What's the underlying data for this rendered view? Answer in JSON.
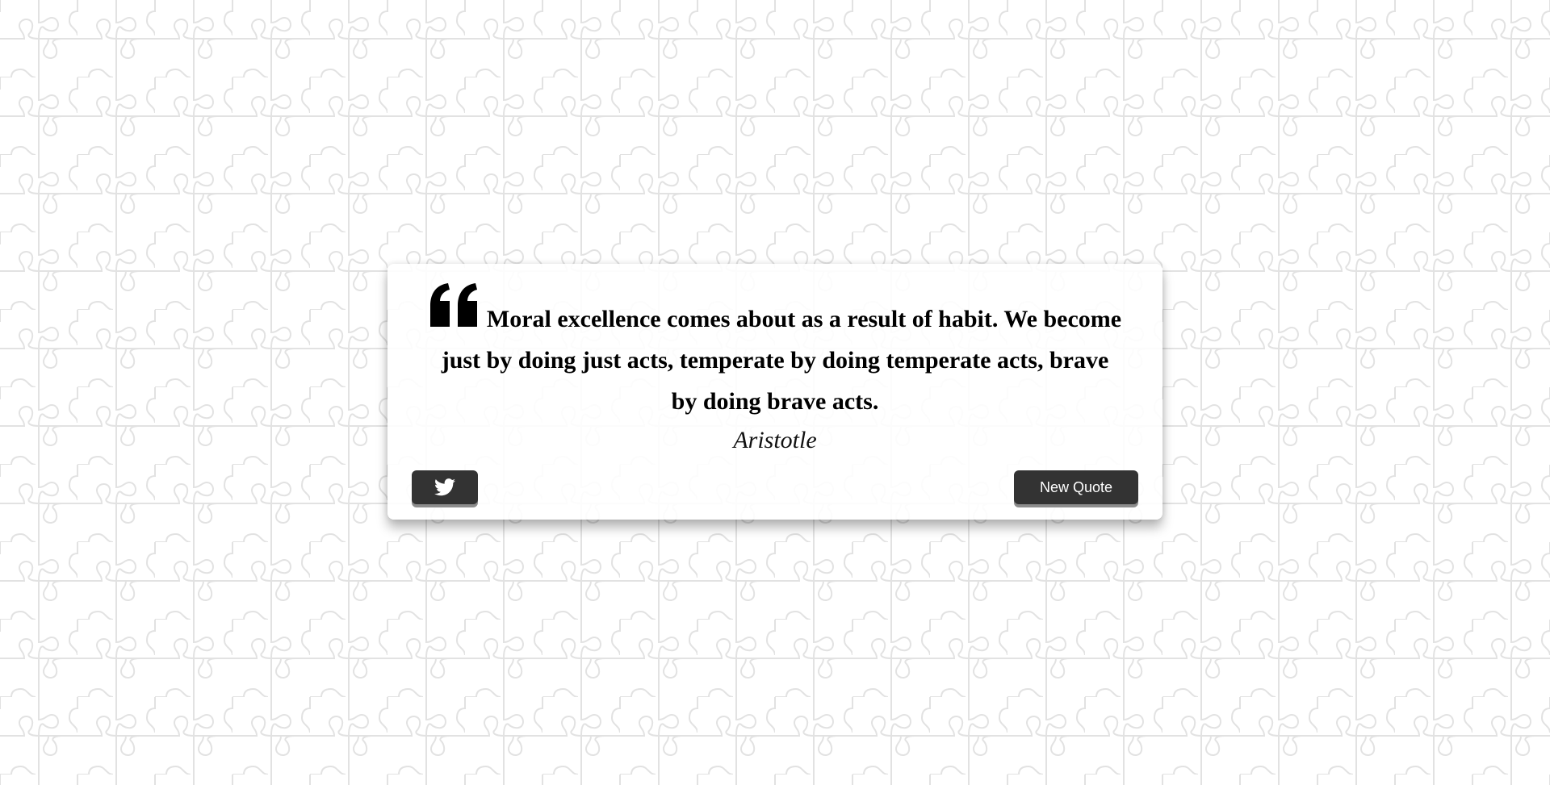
{
  "quote": {
    "text": "Moral excellence comes about as a result of habit. We become just by doing just acts, temperate by doing temperate acts, brave by doing brave acts.",
    "author": "Aristotle"
  },
  "buttons": {
    "tweet_icon": "twitter-icon",
    "new_quote_label": "New Quote"
  },
  "theme": {
    "button_color": "#333333",
    "background_color": "#ffffff",
    "pattern_color": "#e2e2e2",
    "quote_icon": "quote-left-icon"
  }
}
